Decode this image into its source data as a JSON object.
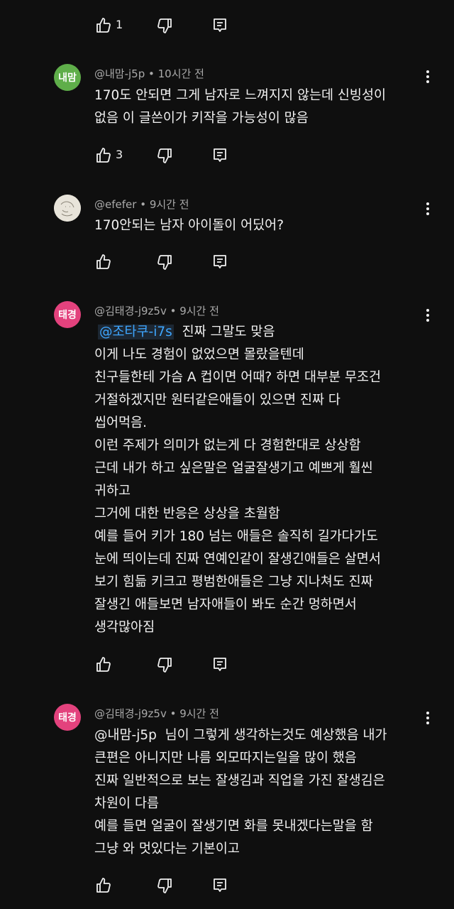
{
  "top_actions": {
    "like_count": "1"
  },
  "comments": [
    {
      "avatar_text": "내맘",
      "avatar_color": "#5fae4a",
      "author": "@내맘-j5p",
      "time": "10시간 전",
      "lines": [
        "170도 안되면 그게 남자로 느껴지지 않는데 신빙성이",
        "없음 이 글쓴이가 키작을 가능성이 많음"
      ],
      "like_count": "3"
    },
    {
      "avatar_text": "",
      "avatar_color": "#e8e4da",
      "author": "@efefer",
      "time": "9시간 전",
      "lines": [
        "170안되는 남자 아이돌이 어딨어?"
      ],
      "like_count": ""
    },
    {
      "avatar_text": "태경",
      "avatar_color": "#e3427d",
      "author": "@김태경-j9z5v",
      "time": "9시간 전",
      "mention": "@조타쿠-i7s",
      "first_line_rest": "진짜 그말도 맞음",
      "lines": [
        "이게 나도 경험이 없었으면 몰랐을텐데",
        "친구들한테 가슴 A 컵이면 어때? 하면 대부분 무조건",
        "거절하겠지만 원터같은애들이 있으면 진짜 다",
        "씹어먹음.",
        "이런 주제가 의미가 없는게 다 경험한대로 상상함",
        "근데 내가 하고 싶은말은 얼굴잘생기고 예쁘게 훨씬",
        "귀하고",
        "그거에 대한 반응은 상상을 초월함",
        "예를 들어 키가 180 넘는 애들은 솔직히 길가다가도",
        "눈에 띄이는데 진짜 연예인같이 잘생긴애들은 살면서",
        "보기 힘듦 키크고 평범한애들은 그냥 지나쳐도 진짜",
        "잘생긴 애들보면 남자애들이 봐도 순간 멍하면서",
        "생각많아짐"
      ],
      "like_count": ""
    },
    {
      "avatar_text": "태경",
      "avatar_color": "#e3427d",
      "author": "@김태경-j9z5v",
      "time": "9시간 전",
      "mention": "@내맘-j5p",
      "first_line_rest": "님이 그렇게 생각하는것도 예상했음 내가",
      "lines": [
        "큰편은 아니지만 나름 외모따지는일을 많이 했음",
        "진짜 일반적으로 보는 잘생김과 직업을 가진 잘생김은",
        "차원이 다름",
        "예를 들면 얼굴이 잘생기면 화를 못내겠다는말을 함",
        "그냥 와 멋있다는 기본이고"
      ],
      "like_count": ""
    }
  ]
}
